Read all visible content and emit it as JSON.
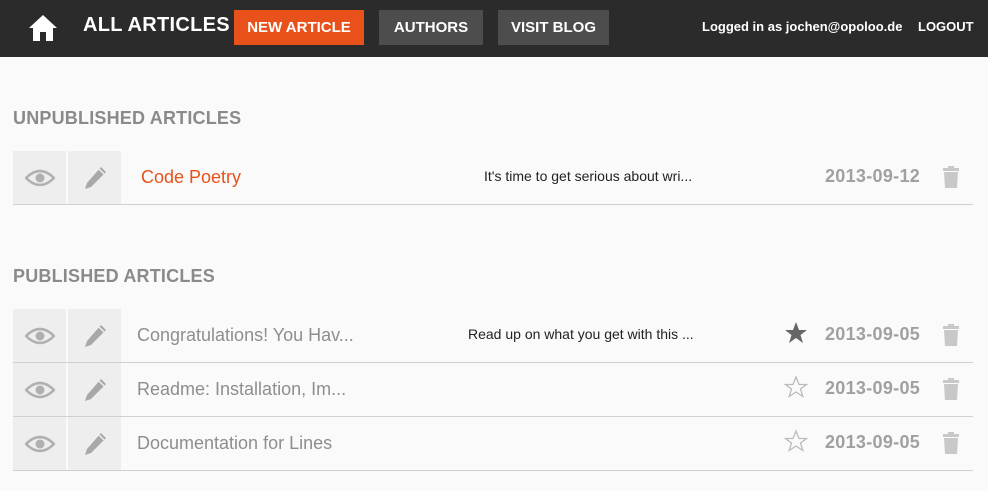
{
  "header": {
    "title": "ALL ARTICLES",
    "new_article": "NEW ARTICLE",
    "authors": "AUTHORS",
    "visit_blog": "VISIT BLOG",
    "logged_in": "Logged in as jochen@opoloo.de",
    "logout": "LOGOUT"
  },
  "colors": {
    "accent": "#e8521a",
    "topbar": "#2b2b2b",
    "muted": "#8e8e8e"
  },
  "unpublished": {
    "heading": "UNPUBLISHED ARTICLES",
    "articles": [
      {
        "title": "Code Poetry",
        "summary": "It's time to get serious about wri...",
        "date": "2013-09-12"
      }
    ]
  },
  "published": {
    "heading": "PUBLISHED ARTICLES",
    "articles": [
      {
        "title": "Congratulations! You Hav...",
        "summary": "Read up on what you get with this ...",
        "starred": true,
        "date": "2013-09-05"
      },
      {
        "title": "Readme: Installation, Im...",
        "summary": "",
        "starred": false,
        "date": "2013-09-05"
      },
      {
        "title": "Documentation for Lines",
        "summary": "",
        "starred": false,
        "date": "2013-09-05"
      }
    ]
  }
}
